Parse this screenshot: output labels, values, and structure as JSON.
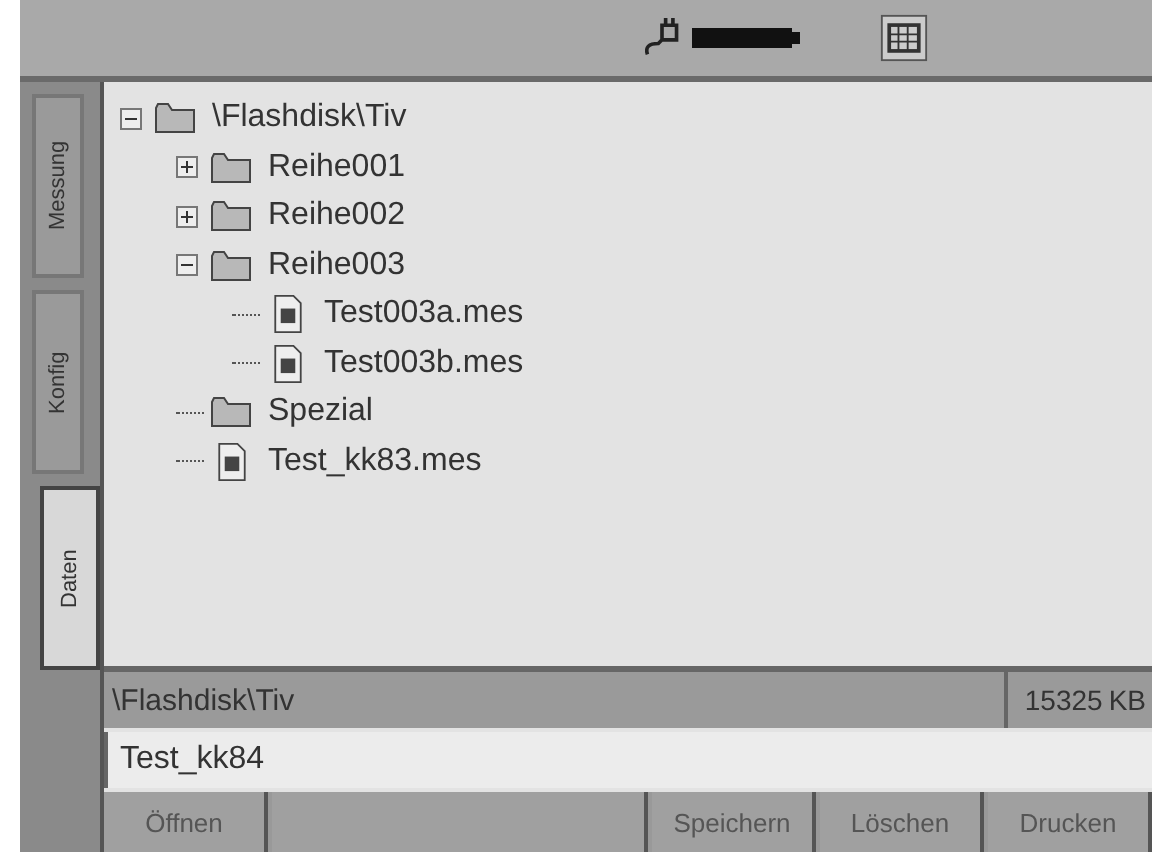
{
  "side_tabs": [
    {
      "label": "Messung",
      "selected": false
    },
    {
      "label": "Konfig",
      "selected": false
    },
    {
      "label": "Daten",
      "selected": true
    }
  ],
  "tree": [
    {
      "kind": "folder",
      "label": "\\Flashdisk\\Tiv",
      "expanded": true,
      "children": [
        {
          "kind": "folder",
          "label": "Reihe001",
          "expanded": false
        },
        {
          "kind": "folder",
          "label": "Reihe002",
          "expanded": false
        },
        {
          "kind": "folder",
          "label": "Reihe003",
          "expanded": true,
          "children": [
            {
              "kind": "file",
              "label": "Test003a.mes"
            },
            {
              "kind": "file",
              "label": "Test003b.mes"
            }
          ]
        },
        {
          "kind": "folder",
          "label": "Spezial"
        },
        {
          "kind": "file",
          "label": "Test_kk83.mes"
        }
      ]
    }
  ],
  "path_bar": {
    "path": "\\Flashdisk\\Tiv",
    "free_space": "15325",
    "unit": "KB"
  },
  "filename_field": {
    "value": "Test_kk84"
  },
  "buttons": [
    {
      "kind": "action",
      "label": "Öffnen"
    },
    {
      "kind": "blank"
    },
    {
      "kind": "action",
      "label": "Speichern"
    },
    {
      "kind": "action",
      "label": "Löschen"
    },
    {
      "kind": "action",
      "label": "Drucken"
    }
  ]
}
